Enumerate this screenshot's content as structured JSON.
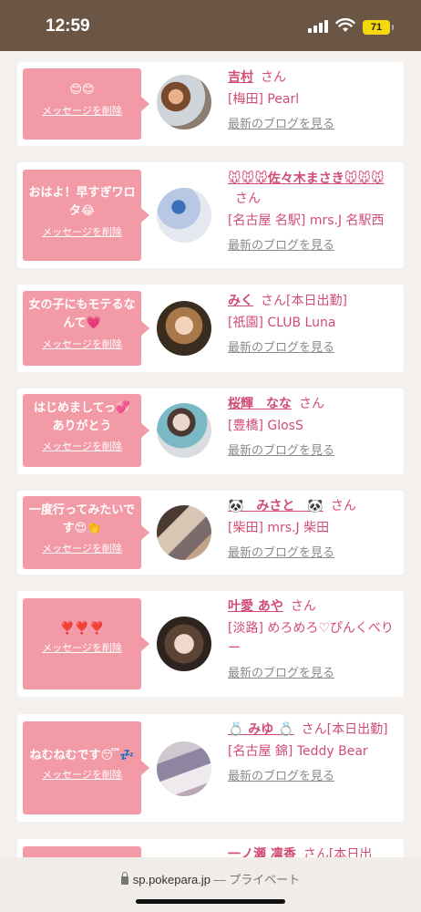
{
  "status_bar": {
    "time": "12:59",
    "battery": "71"
  },
  "browser": {
    "url": "sp.pokepara.jp",
    "separator": " — ",
    "mode": "プライベート"
  },
  "messages": [
    {
      "text": "😊😊",
      "delete_label": "メッセージを削除",
      "name": "吉村",
      "name_suffix": "さん",
      "badge": "",
      "shop": "[梅田] Pearl",
      "blog_label": "最新のブログを見る"
    },
    {
      "text": "おはよ！早すぎワロタ😂",
      "delete_label": "メッセージを削除",
      "name": "🐭🐭🐭佐々木まさき🐭🐭🐭",
      "name_suffix": "さん",
      "badge": "",
      "shop": "[名古屋 名駅] mrs.J 名駅西",
      "blog_label": "最新のブログを見る"
    },
    {
      "text": "女の子にもモテるなんて💗",
      "delete_label": "メッセージを削除",
      "name": "みく",
      "name_suffix": "さん",
      "badge": "[本日出勤]",
      "shop": "[祇園] CLUB Luna",
      "blog_label": "最新のブログを見る"
    },
    {
      "text": "はじめましてっ💞ありがとう",
      "delete_label": "メッセージを削除",
      "name": "桜輝　なな",
      "name_suffix": "さん",
      "badge": "",
      "shop": "[豊橋] GlosS",
      "blog_label": "最新のブログを見る"
    },
    {
      "text": "一度行ってみたいです😍👏",
      "delete_label": "メッセージを削除",
      "name": "🐼　みさと　🐼",
      "name_suffix": "さん",
      "badge": "",
      "shop": "[柴田] mrs.J 柴田",
      "blog_label": "最新のブログを見る"
    },
    {
      "text": "❣️❣️❣️",
      "delete_label": "メッセージを削除",
      "name": "叶愛 あや",
      "name_suffix": "さん",
      "badge": "",
      "shop": "[淡路] めろめろ♡ぴんくべりー",
      "blog_label": "最新のブログを見る"
    },
    {
      "text": "ねむねむです😴💤",
      "delete_label": "メッセージを削除",
      "name": "💍 みゆ 💍",
      "name_suffix": "さん",
      "badge": "[本日出勤]",
      "shop": "[名古屋 錦] Teddy Bear",
      "blog_label": "最新のブログを見る"
    },
    {
      "text": "",
      "delete_label": "",
      "name": "一ノ瀬 凛香",
      "name_suffix": "さん",
      "badge": "[本日出",
      "shop": "",
      "blog_label": ""
    }
  ]
}
